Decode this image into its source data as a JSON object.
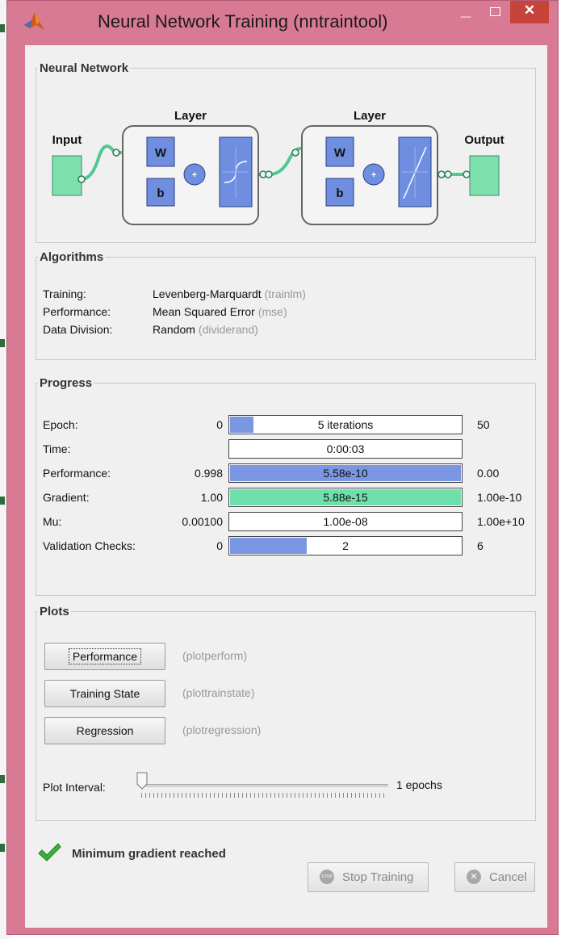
{
  "window": {
    "title": "Neural Network Training (nntraintool)"
  },
  "neural_network": {
    "legend": "Neural Network",
    "input_label": "Input",
    "output_label": "Output",
    "layers": [
      {
        "label": "Layer",
        "weight": "W",
        "bias": "b",
        "sum": "+",
        "transfer": "tansig"
      },
      {
        "label": "Layer",
        "weight": "W",
        "bias": "b",
        "sum": "+",
        "transfer": "purelin"
      }
    ]
  },
  "algorithms": {
    "legend": "Algorithms",
    "rows": [
      {
        "label": "Training:",
        "value": "Levenberg-Marquardt",
        "hint": "(trainlm)"
      },
      {
        "label": "Performance:",
        "value": "Mean Squared Error",
        "hint": "(mse)"
      },
      {
        "label": "Data Division:",
        "value": "Random",
        "hint": "(dividerand)"
      }
    ]
  },
  "progress": {
    "legend": "Progress",
    "rows": [
      {
        "label": "Epoch:",
        "min": "0",
        "text": "5 iterations",
        "max": "50",
        "fill": 0.1,
        "color": "#7b97e3"
      },
      {
        "label": "Time:",
        "min": "",
        "text": "0:00:03",
        "max": "",
        "fill": 0,
        "color": "#7b97e3"
      },
      {
        "label": "Performance:",
        "min": "0.998",
        "text": "5.58e-10",
        "max": "0.00",
        "fill": 1.0,
        "color": "#7b97e3"
      },
      {
        "label": "Gradient:",
        "min": "1.00",
        "text": "5.88e-15",
        "max": "1.00e-10",
        "fill": 1.0,
        "color": "#6fe0ac"
      },
      {
        "label": "Mu:",
        "min": "0.00100",
        "text": "1.00e-08",
        "max": "1.00e+10",
        "fill": 0,
        "color": "#7b97e3"
      },
      {
        "label": "Validation Checks:",
        "min": "0",
        "text": "2",
        "max": "6",
        "fill": 0.333,
        "color": "#7b97e3"
      }
    ]
  },
  "plots": {
    "legend": "Plots",
    "buttons": [
      {
        "label": "Performance",
        "hint": "(plotperform)"
      },
      {
        "label": "Training State",
        "hint": "(plottrainstate)"
      },
      {
        "label": "Regression",
        "hint": "(plotregression)"
      }
    ],
    "interval_label": "Plot Interval:",
    "interval_value": "1 epochs",
    "interval_level": 0
  },
  "status": {
    "icon": "checkmark-icon",
    "text": "Minimum gradient reached"
  },
  "buttons": {
    "stop": "Stop Training",
    "stop_icon_text": "STOP",
    "cancel": "Cancel"
  },
  "colors": {
    "titlebar": "#d97a94",
    "close": "#c7443b",
    "node_green": "#7ee0ad",
    "block_blue": "#6f8ee0",
    "progress_blue": "#7b97e3",
    "progress_green": "#6fe0ac",
    "check_green": "#39b33a"
  }
}
